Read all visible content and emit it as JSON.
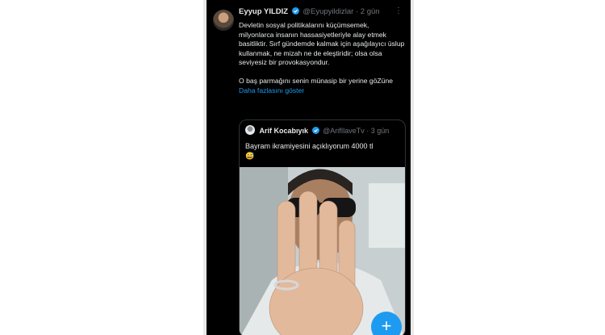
{
  "tweet": {
    "author_name": "Eyyup YILDIZ",
    "handle": "@Eyupyildizlar",
    "time": "2 gün",
    "paragraph1": "Devletin sosyal politikalarını küçümsemek, milyonlarca insanın hassasiyetleriyle alay etmek basitliktir. Sırf gündemde kalmak için aşağılayıcı üslup kullanmak, ne mizah ne de eleştiridir; olsa olsa seviyesiz bir provokasyondur.",
    "paragraph2": "O baş parmağını senin münasip bir yerine göZüne",
    "show_more": "Daha fazlasını göster"
  },
  "quote": {
    "author_name": "Arif Kocabıyık",
    "handle": "@ArifIlaveTv",
    "time": "3 gün",
    "text": "Bayram ikramiyesini açıklıyorum 4000 tl",
    "emoji": "😅"
  },
  "fab": {
    "label": "+"
  },
  "colors": {
    "accent": "#1d9bf0",
    "background": "#000000"
  }
}
